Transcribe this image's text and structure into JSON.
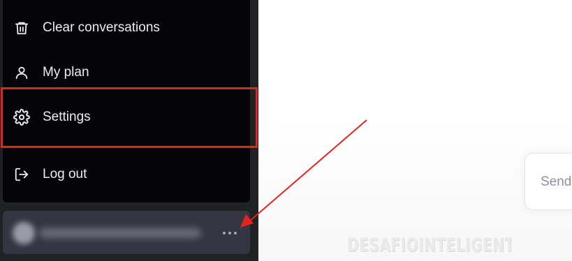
{
  "menu": {
    "items": [
      {
        "label": "Clear conversations",
        "icon": "trash-icon"
      },
      {
        "label": "My plan",
        "icon": "user-icon"
      },
      {
        "label": "Settings",
        "icon": "gear-icon"
      },
      {
        "label": "Log out",
        "icon": "logout-icon"
      }
    ]
  },
  "user": {
    "more_icon": "ellipsis-icon"
  },
  "input": {
    "placeholder": "Send"
  },
  "watermark": {
    "text": "DESAFIOINTELIGENTE.COM"
  },
  "colors": {
    "sidebar_bg": "#202123",
    "menu_bg": "#050509",
    "highlight": "#e32320",
    "arrow": "#e32320"
  }
}
